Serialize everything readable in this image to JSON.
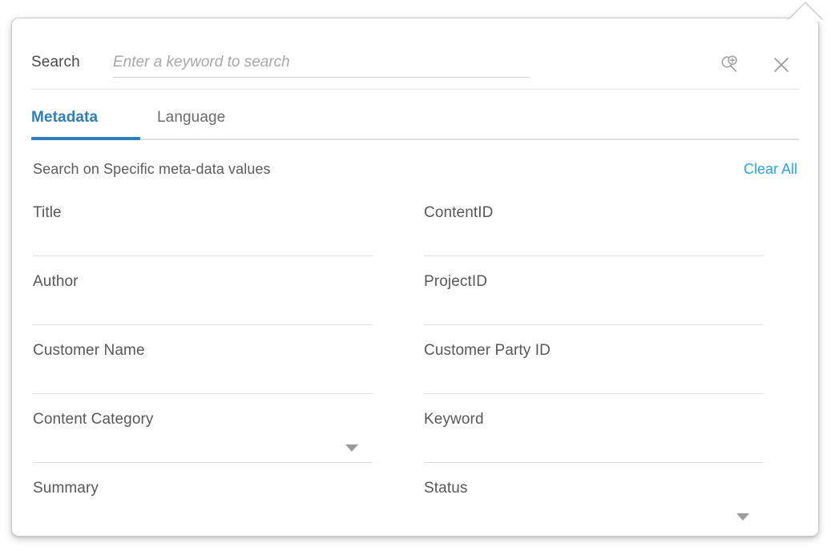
{
  "panel": {
    "name": "search-popover"
  },
  "search": {
    "label": "Search",
    "placeholder": "Enter a keyword to search",
    "value": "",
    "advanced_icon": "advanced-search-icon",
    "close_icon": "close-icon"
  },
  "tabs": [
    {
      "label": "Metadata",
      "active": true
    },
    {
      "label": "Language",
      "active": false
    }
  ],
  "section": {
    "title": "Search on Specific meta-data values",
    "clear_all": "Clear All"
  },
  "colors": {
    "accent_blue": "#2d7ebc",
    "link_blue": "#29a3f5",
    "label_gray": "#58585a",
    "underline_gray": "#e0e0e0",
    "panel_border": "#c9c9c9"
  },
  "fields": {
    "left": [
      {
        "label": "Title",
        "value": "",
        "type": "text"
      },
      {
        "label": "Author",
        "value": "",
        "type": "text"
      },
      {
        "label": "Customer Name",
        "value": "",
        "type": "text"
      },
      {
        "label": "Content Category",
        "value": "",
        "type": "select"
      },
      {
        "label": "Summary",
        "value": "",
        "type": "text"
      }
    ],
    "right": [
      {
        "label": "ContentID",
        "value": "",
        "type": "text"
      },
      {
        "label": "ProjectID",
        "value": "",
        "type": "text"
      },
      {
        "label": "Customer Party ID",
        "value": "",
        "type": "text"
      },
      {
        "label": "Keyword",
        "value": "",
        "type": "text"
      },
      {
        "label": "Status",
        "value": "",
        "type": "select"
      }
    ]
  }
}
